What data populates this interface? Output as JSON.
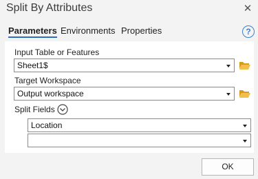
{
  "window": {
    "title": "Split By Attributes",
    "close_glyph": "✕"
  },
  "tabs": [
    {
      "label": "Parameters",
      "active": true
    },
    {
      "label": "Environments",
      "active": false
    },
    {
      "label": "Properties",
      "active": false
    }
  ],
  "help": {
    "glyph": "?",
    "icon": "help-icon"
  },
  "params": {
    "input_label": "Input Table or Features",
    "input_value": "Sheet1$",
    "workspace_label": "Target Workspace",
    "workspace_value": "Output workspace",
    "split_label": "Split Fields",
    "split_fields": [
      "Location",
      ""
    ]
  },
  "buttons": {
    "ok_label": "OK"
  },
  "colors": {
    "accent": "#2a6ebd",
    "folder": "#e8b23a",
    "help": "#3a7fcc"
  }
}
